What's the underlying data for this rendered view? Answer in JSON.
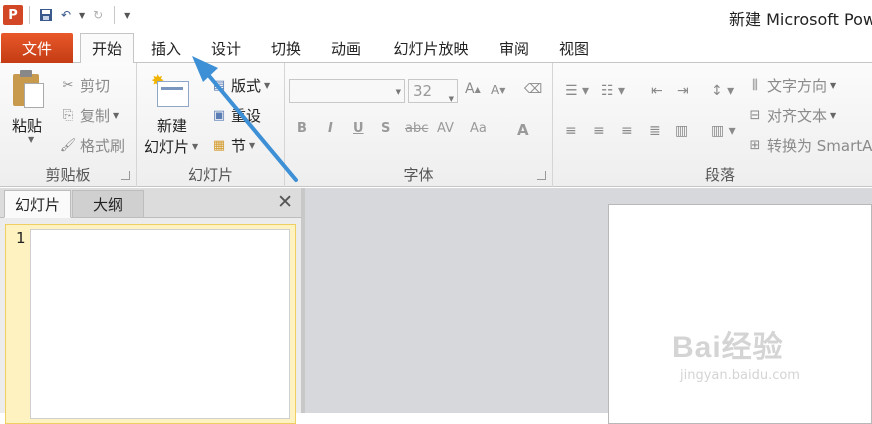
{
  "app": {
    "logo_letter": "P",
    "window_title": "新建 Microsoft Pow"
  },
  "qat": {
    "save_icon": "save-icon",
    "undo_icon": "undo-icon",
    "redo_icon": "redo-icon",
    "customize_icon": "customize-qat-icon"
  },
  "tabs": {
    "file": "文件",
    "home": "开始",
    "insert": "插入",
    "design": "设计",
    "transitions": "切换",
    "animations": "动画",
    "slideshow": "幻灯片放映",
    "review": "审阅",
    "view": "视图"
  },
  "clipboard": {
    "paste": "粘贴",
    "cut": "剪切",
    "copy": "复制",
    "format_painter": "格式刷",
    "label": "剪贴板"
  },
  "slides": {
    "new_slide_line1": "新建",
    "new_slide_line2": "幻灯片",
    "layout": "版式",
    "reset": "重设",
    "section": "节",
    "label": "幻灯片"
  },
  "font": {
    "font_name": "",
    "font_size": "32",
    "grow": "A",
    "shrink": "A",
    "bold": "B",
    "italic": "I",
    "underline": "U",
    "shadow": "S",
    "strike": "abc",
    "spacing": "AV",
    "case": "Aa",
    "color": "A",
    "label": "字体"
  },
  "paragraph": {
    "text_direction": "文字方向",
    "align_text": "对齐文本",
    "convert_smartart": "转换为 SmartA",
    "label": "段落"
  },
  "pane": {
    "tab_slides": "幻灯片",
    "tab_outline": "大纲",
    "close": "✕",
    "slide_number": "1"
  },
  "watermark": {
    "logo_text": "Bai经验",
    "url": "jingyan.baidu.com"
  },
  "colors": {
    "file_tab": "#d24726",
    "annotation_arrow": "#3d8fd6"
  }
}
